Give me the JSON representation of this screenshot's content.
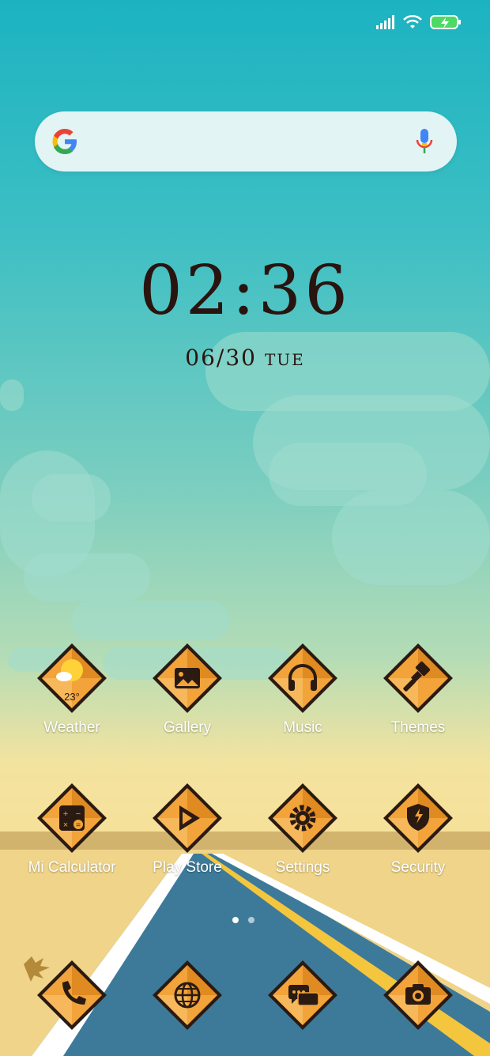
{
  "status_bar": {
    "signal_icon": "cellular-signal-icon",
    "wifi_icon": "wifi-icon",
    "battery_icon": "battery-charging-icon",
    "battery_color": "#4cd964"
  },
  "search": {
    "logo_icon": "google-g-icon",
    "mic_icon": "microphone-icon"
  },
  "clock": {
    "time": "02:36",
    "date": "06/30",
    "weekday": "TUE"
  },
  "apps": [
    {
      "label": "Weather",
      "icon": "weather-icon",
      "temp": "23°"
    },
    {
      "label": "Gallery",
      "icon": "gallery-icon"
    },
    {
      "label": "Music",
      "icon": "headphones-icon"
    },
    {
      "label": "Themes",
      "icon": "paintbrush-icon"
    },
    {
      "label": "Mi Calculator",
      "icon": "calculator-icon"
    },
    {
      "label": "Play Store",
      "icon": "play-store-icon"
    },
    {
      "label": "Settings",
      "icon": "gear-icon"
    },
    {
      "label": "Security",
      "icon": "shield-icon"
    }
  ],
  "dock": [
    {
      "icon": "phone-icon"
    },
    {
      "icon": "browser-icon"
    },
    {
      "icon": "messages-icon"
    },
    {
      "icon": "camera-icon"
    }
  ],
  "pager": {
    "pages": 2,
    "active": 1
  },
  "colors": {
    "tile_orange": "#f2a33a",
    "tile_dark": "#2a1a12",
    "clock_text": "#2a1410"
  }
}
